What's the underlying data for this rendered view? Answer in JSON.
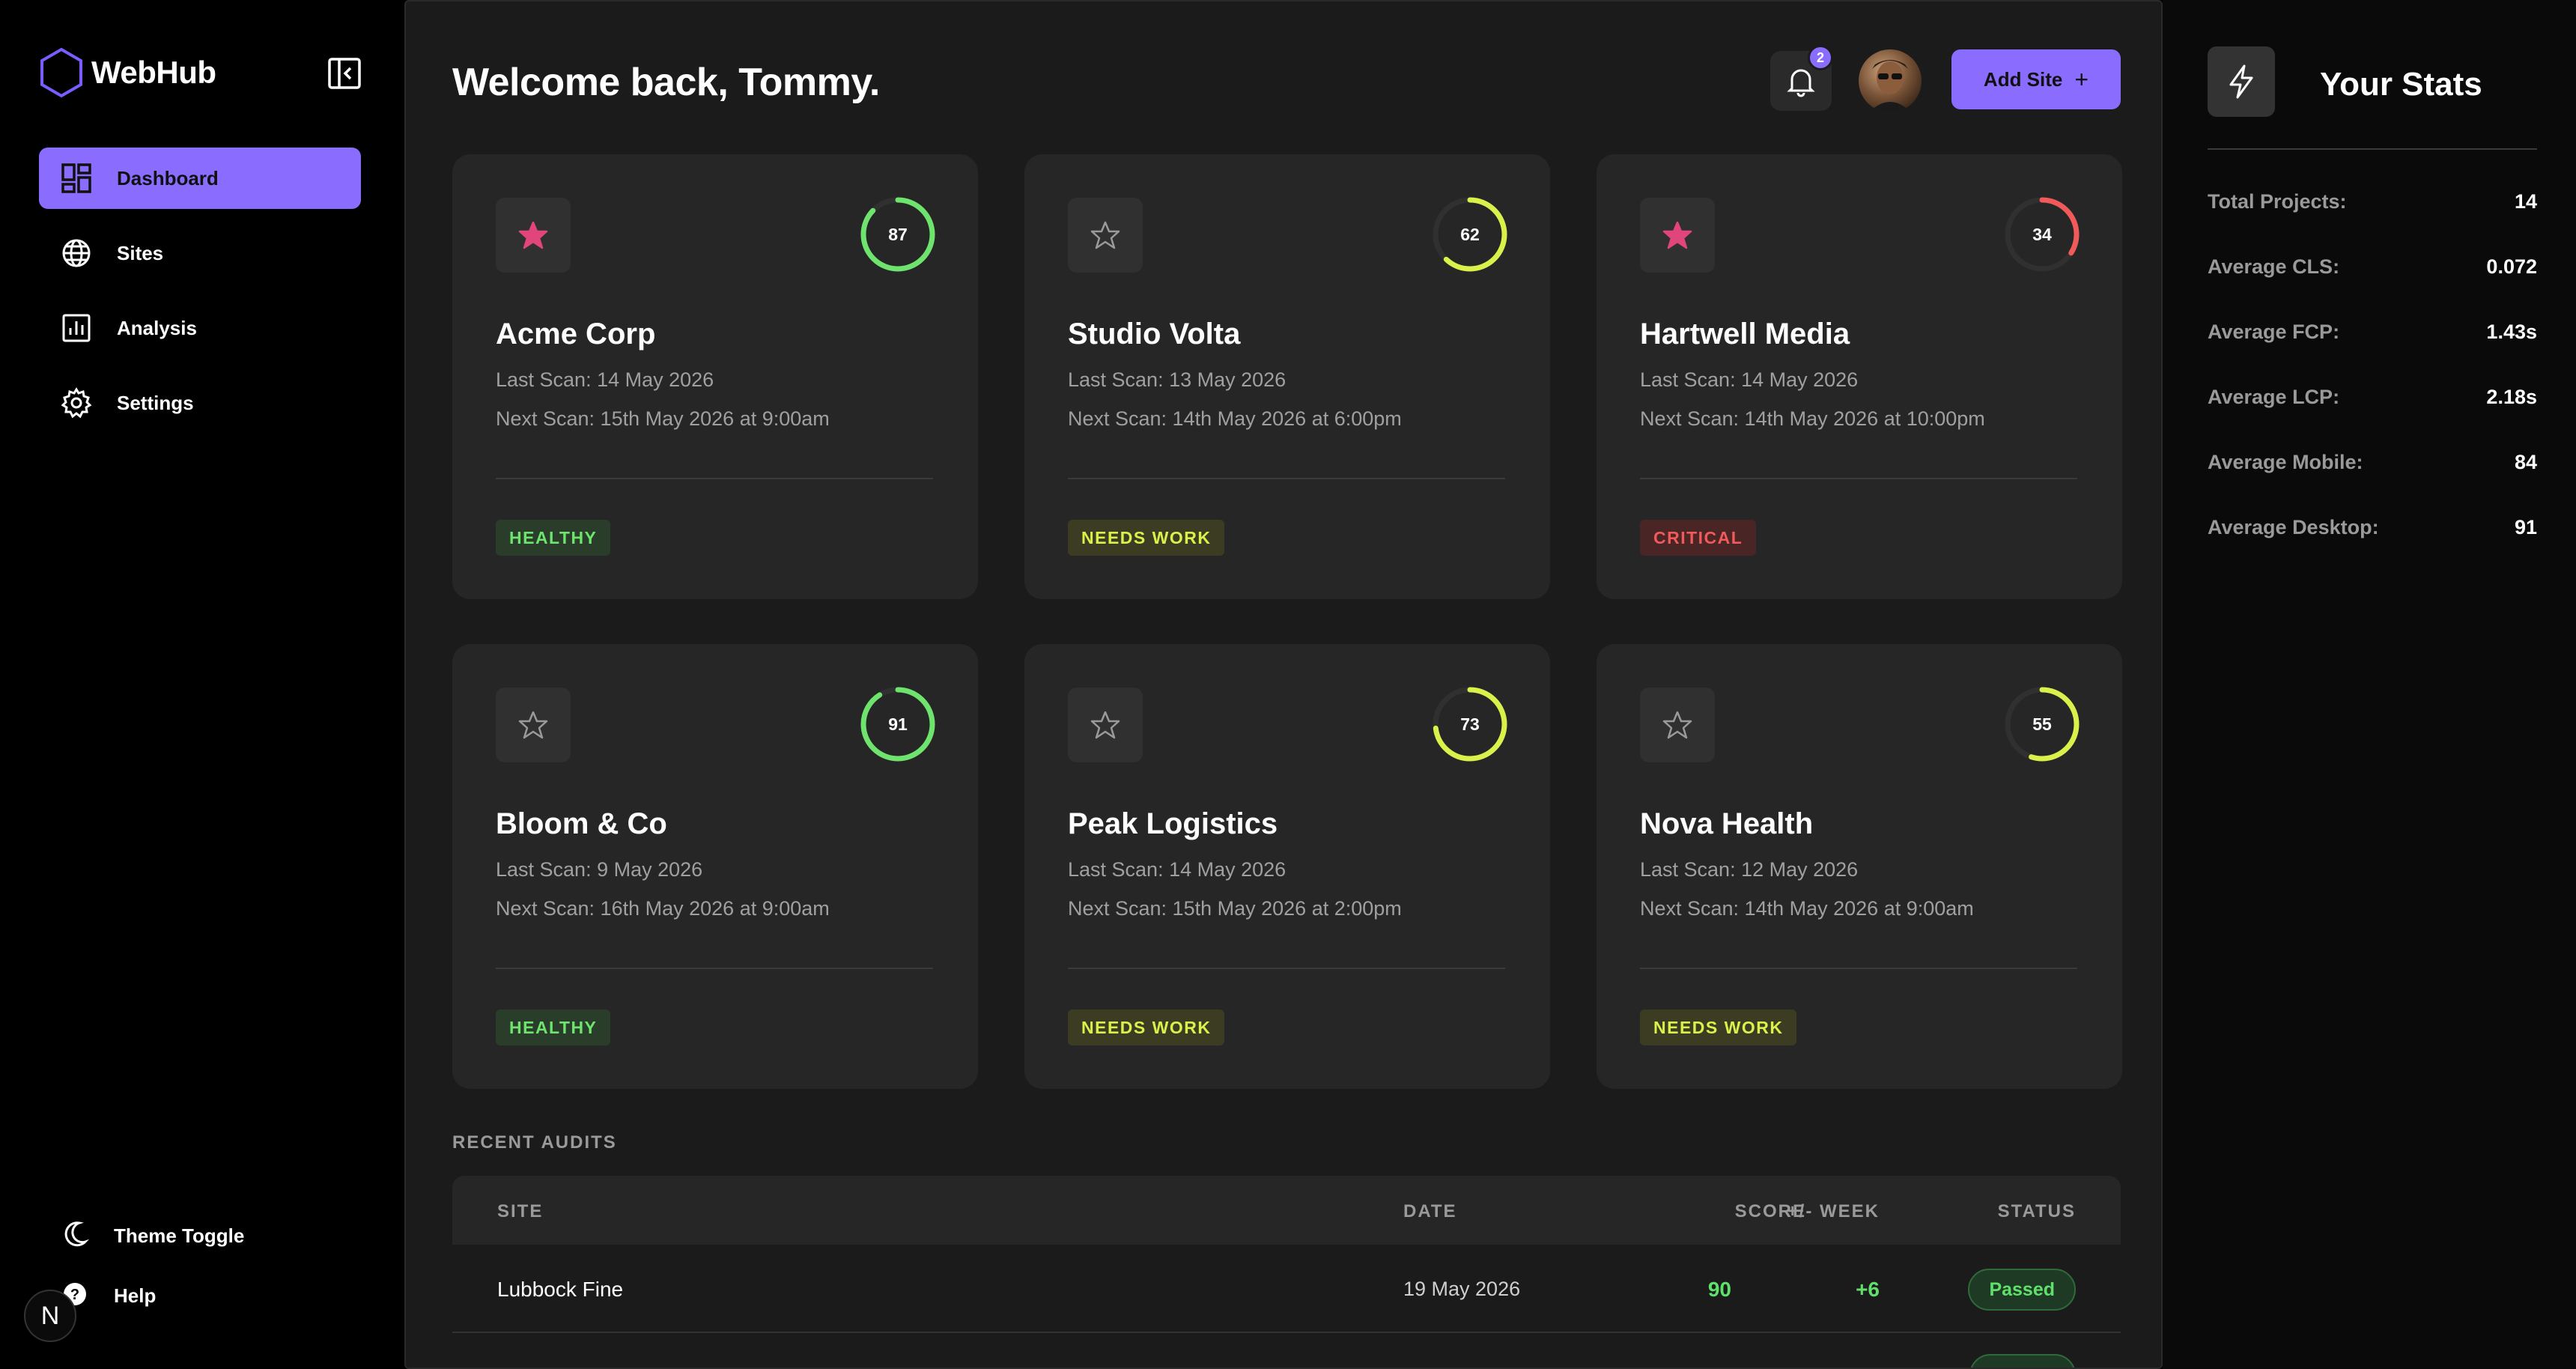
{
  "brand": {
    "name": "WebHub"
  },
  "nav": [
    {
      "label": "Dashboard",
      "icon": "dashboard-icon",
      "active": true
    },
    {
      "label": "Sites",
      "icon": "globe-icon"
    },
    {
      "label": "Analysis",
      "icon": "chart-icon"
    },
    {
      "label": "Settings",
      "icon": "gear-icon"
    }
  ],
  "sidebar_bottom": {
    "theme_toggle": "Theme Toggle",
    "help": "Help",
    "next_badge": "N"
  },
  "header": {
    "welcome": "Welcome back, Tommy.",
    "notifications": "2",
    "add_site": "Add Site",
    "add_site_icon": "+"
  },
  "cards": [
    {
      "title": "Acme Corp",
      "last_scan": "Last Scan: 14 May 2026",
      "next_scan": "Next Scan: 15th May 2026 at 9:00am",
      "score": "87",
      "score_pct": 87,
      "starred": true,
      "status": "HEALTHY",
      "status_type": "healthy"
    },
    {
      "title": "Studio Volta",
      "last_scan": "Last Scan: 13 May 2026",
      "next_scan": "Next Scan: 14th May 2026 at 6:00pm",
      "score": "62",
      "score_pct": 62,
      "starred": false,
      "status": "NEEDS WORK",
      "status_type": "needs"
    },
    {
      "title": "Hartwell Media",
      "last_scan": "Last Scan: 14 May 2026",
      "next_scan": "Next Scan: 14th May 2026 at 10:00pm",
      "score": "34",
      "score_pct": 34,
      "starred": true,
      "status": "CRITICAL",
      "status_type": "critical"
    },
    {
      "title": "Bloom & Co",
      "last_scan": "Last Scan: 9 May 2026",
      "next_scan": "Next Scan: 16th May 2026 at 9:00am",
      "score": "91",
      "score_pct": 91,
      "starred": false,
      "status": "HEALTHY",
      "status_type": "healthy"
    },
    {
      "title": "Peak Logistics",
      "last_scan": "Last Scan: 14 May 2026",
      "next_scan": "Next Scan: 15th May 2026 at 2:00pm",
      "score": "73",
      "score_pct": 73,
      "starred": false,
      "status": "NEEDS WORK",
      "status_type": "needs"
    },
    {
      "title": "Nova Health",
      "last_scan": "Last Scan: 12 May 2026",
      "next_scan": "Next Scan: 14th May 2026 at 9:00am",
      "score": "55",
      "score_pct": 55,
      "starred": false,
      "status": "NEEDS WORK",
      "status_type": "needs"
    }
  ],
  "colors": {
    "accent": "#8a6cff",
    "healthy": "#6ee46e",
    "needs": "#d9f14a",
    "critical": "#f05a5a",
    "star_filled": "#e0457b"
  },
  "audits": {
    "label": "RECENT AUDITS",
    "columns": {
      "site": "SITE",
      "date": "DATE",
      "score": "SCORE",
      "week": "+/- WEEK",
      "status": "STATUS"
    },
    "rows": [
      {
        "site": "Lubbock Fine",
        "date": "19 May 2026",
        "score": "90",
        "week": "+6",
        "status": "Passed"
      }
    ]
  },
  "stats": {
    "title": "Your Stats",
    "items": [
      {
        "label": "Total Projects:",
        "value": "14"
      },
      {
        "label": "Average CLS:",
        "value": "0.072"
      },
      {
        "label": "Average FCP:",
        "value": "1.43s"
      },
      {
        "label": "Average LCP:",
        "value": "2.18s"
      },
      {
        "label": "Average Mobile:",
        "value": "84"
      },
      {
        "label": "Average Desktop:",
        "value": "91"
      }
    ]
  }
}
